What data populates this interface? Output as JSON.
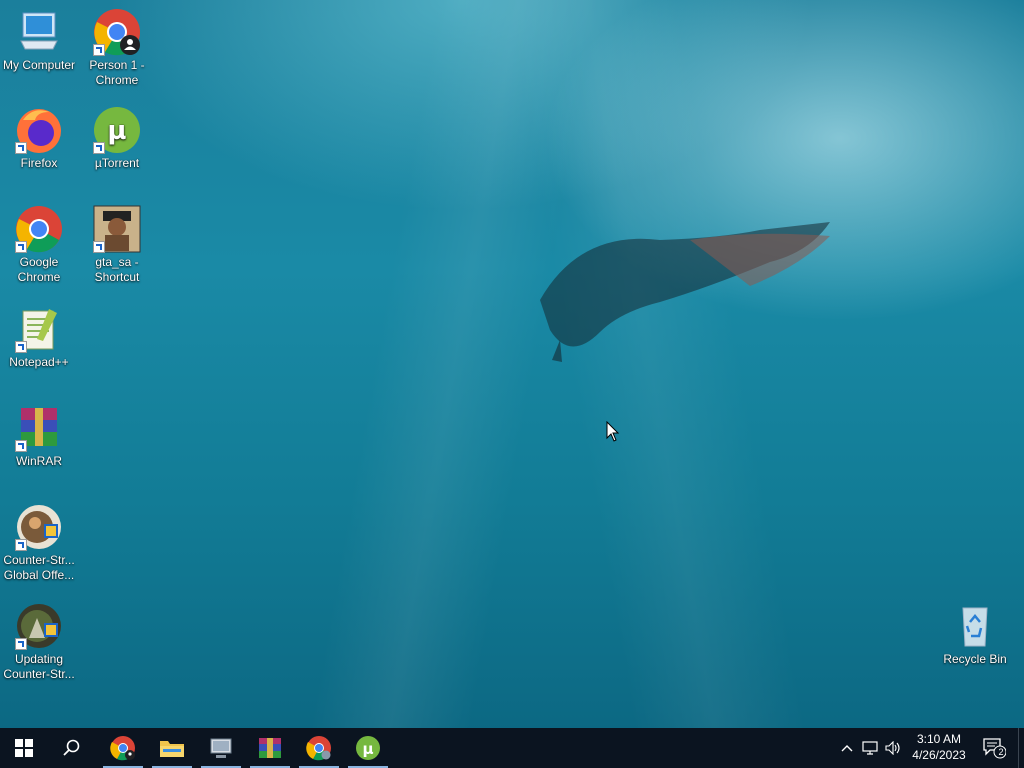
{
  "desktop": {
    "icons": [
      {
        "id": "my-computer",
        "label": "My Computer"
      },
      {
        "id": "person1-chrome",
        "label": "Person 1 - Chrome"
      },
      {
        "id": "firefox",
        "label": "Firefox"
      },
      {
        "id": "utorrent",
        "label": "µTorrent"
      },
      {
        "id": "google-chrome",
        "label": "Google Chrome"
      },
      {
        "id": "gta-sa",
        "label": "gta_sa - Shortcut"
      },
      {
        "id": "notepadpp",
        "label": "Notepad++"
      },
      {
        "id": "winrar",
        "label": "WinRAR"
      },
      {
        "id": "csgo",
        "label": "Counter-Str... Global Offe..."
      },
      {
        "id": "updating-cs",
        "label": "Updating Counter-Str..."
      },
      {
        "id": "recycle-bin",
        "label": "Recycle Bin"
      }
    ]
  },
  "taskbar": {
    "pinned": [
      {
        "name": "start-button"
      },
      {
        "name": "search-button"
      },
      {
        "name": "chrome-profile-taskbar"
      },
      {
        "name": "file-explorer-taskbar"
      },
      {
        "name": "network-tool-taskbar"
      },
      {
        "name": "winrar-taskbar"
      },
      {
        "name": "chrome-taskbar"
      },
      {
        "name": "utorrent-taskbar"
      }
    ],
    "tray": {
      "time": "3:10 AM",
      "date": "4/26/2023",
      "notification_count": "2"
    }
  },
  "colors": {
    "taskbar": "#0b1420",
    "accent": "#8ab4e0"
  }
}
